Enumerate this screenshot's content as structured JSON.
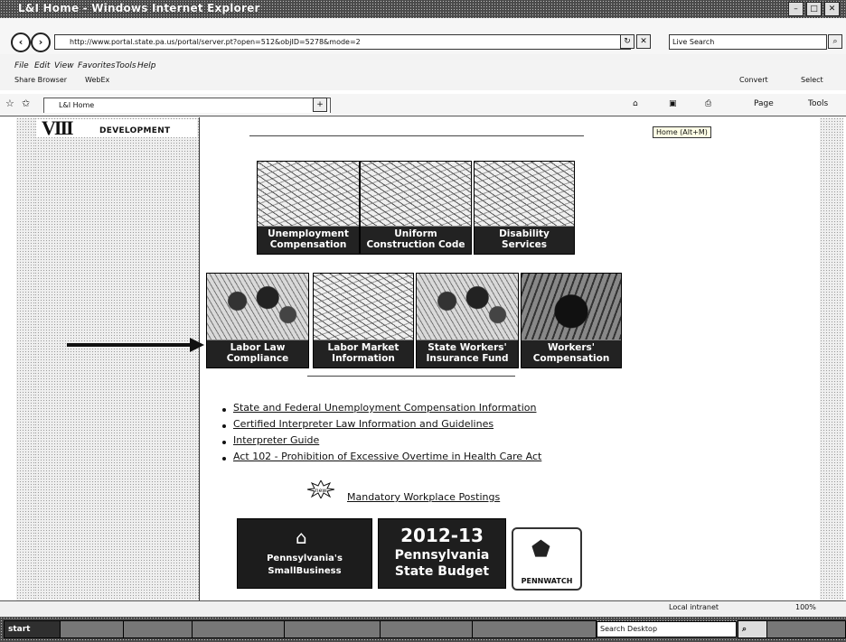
{
  "window": {
    "title": "L&I Home - Windows Internet Explorer",
    "min_icon": "minimize-icon",
    "max_icon": "maximize-icon",
    "close_icon": "close-icon"
  },
  "addressbar": {
    "url": "http://www.portal.state.pa.us/portal/server.pt?open=512&objID=5278&mode=2",
    "search_placeholder": "Live Search"
  },
  "menubar": {
    "items": [
      "File",
      "Edit",
      "View",
      "Favorites",
      "Tools",
      "Help"
    ],
    "share_browser": "Share Browser",
    "webex": "WebEx",
    "convert": "Convert",
    "select": "Select"
  },
  "tabs": {
    "active_tab": "L&I Home"
  },
  "commandbar": {
    "page": "Page",
    "tools": "Tools"
  },
  "tooltip": "Home (Alt+M)",
  "sidebar": {
    "logo_text": "DEVELOPMENT"
  },
  "tiles_row1": [
    {
      "label1": "Unemployment",
      "label2": "Compensation"
    },
    {
      "label1": "Uniform",
      "label2": "Construction Code"
    },
    {
      "label1": "Disability",
      "label2": "Services"
    }
  ],
  "tiles_row2": [
    {
      "label1": "Labor Law",
      "label2": "Compliance"
    },
    {
      "label1": "Labor Market",
      "label2": "Information"
    },
    {
      "label1": "State Workers'",
      "label2": "Insurance Fund"
    },
    {
      "label1": "Workers'",
      "label2": "Compensation"
    }
  ],
  "links": [
    "State and Federal Unemployment Compensation Information",
    "Certified Interpreter Law Information and Guidelines",
    "Interpreter Guide",
    "Act 102 - Prohibition of Excessive Overtime in Health Care Act"
  ],
  "new_badge": "new",
  "postings_link": "Mandatory Workplace Postings",
  "banners": {
    "small_business_1": "Pennsylvania's",
    "small_business_2": "SmallBusiness",
    "budget_year": "2012-13",
    "budget_1": "Pennsylvania",
    "budget_2": "State Budget",
    "pennwatch": "PENNWATCH"
  },
  "statusbar": {
    "zone": "Local intranet",
    "zoom": "100%"
  },
  "taskbar": {
    "start": "start",
    "search_placeholder": "Search Desktop"
  }
}
